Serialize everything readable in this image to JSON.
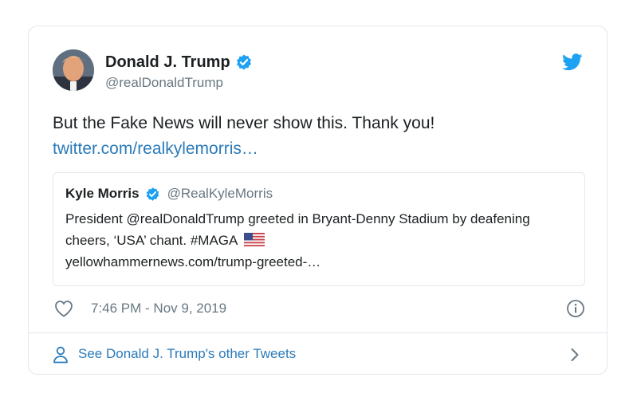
{
  "tweet": {
    "author": {
      "name": "Donald J. Trump",
      "handle": "@realDonaldTrump",
      "verified": true
    },
    "text": "But the Fake News will never show this. Thank you!",
    "link": "twitter.com/realkylemorris…",
    "quote": {
      "author_name": "Kyle Morris",
      "author_handle": "@RealKyleMorris",
      "verified": true,
      "text": "President @realDonaldTrump greeted in Bryant-Denny Stadium by deafening cheers, ‘USA’ chant. #MAGA",
      "flag_icon": "us-flag-icon",
      "link": "yellowhammernews.com/trump-greeted-…"
    },
    "timestamp": "7:46 PM - Nov 9, 2019",
    "footer": {
      "label": "See Donald J. Trump's other Tweets"
    }
  },
  "icons": {
    "verified": "verified-badge-icon",
    "brand": "twitter-bird-icon",
    "like": "heart-icon",
    "info": "info-icon",
    "person": "person-icon",
    "chevron": "chevron-right-icon"
  },
  "colors": {
    "link": "#2b7bb9",
    "secondary_text": "#697882",
    "brand": "#1da1f2",
    "border": "#e1e8ed",
    "text": "#1c2022"
  }
}
